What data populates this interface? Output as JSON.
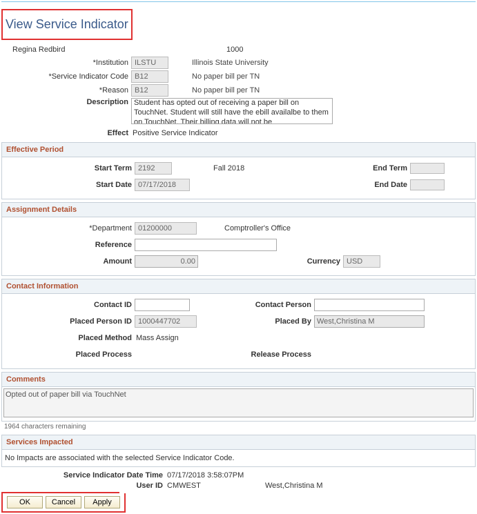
{
  "page_title": "View Service Indicator",
  "person_name": "Regina Redbird",
  "person_id": "1000",
  "fields": {
    "institution_label": "Institution",
    "institution_code": "ILSTU",
    "institution_desc": "Illinois State University",
    "si_code_label": "Service Indicator Code",
    "si_code": "B12",
    "si_code_desc": "No paper bill per TN",
    "reason_label": "Reason",
    "reason_code": "B12",
    "reason_desc": "No paper bill per TN",
    "description_label": "Description",
    "description_text": "Student has opted out of receiving a paper bill on TouchNet.  Student will still have the ebill availalbe to them on TouchNet.  Their billing data will not be",
    "effect_label": "Effect",
    "effect_value": "Positive Service Indicator"
  },
  "sections": {
    "effective_period": {
      "title": "Effective Period",
      "start_term_label": "Start Term",
      "start_term": "2192",
      "start_term_desc": "Fall 2018",
      "end_term_label": "End Term",
      "start_date_label": "Start Date",
      "start_date": "07/17/2018",
      "end_date_label": "End Date"
    },
    "assignment": {
      "title": "Assignment Details",
      "department_label": "Department",
      "department": "01200000",
      "department_desc": "Comptroller's Office",
      "reference_label": "Reference",
      "amount_label": "Amount",
      "amount": "0.00",
      "currency_label": "Currency",
      "currency": "USD"
    },
    "contact": {
      "title": "Contact Information",
      "contact_id_label": "Contact ID",
      "contact_person_label": "Contact Person",
      "placed_person_id_label": "Placed Person ID",
      "placed_person_id": "1000447702",
      "placed_by_label": "Placed By",
      "placed_by": "West,Christina M",
      "placed_method_label": "Placed Method",
      "placed_method": "Mass Assign",
      "placed_process_label": "Placed Process",
      "release_process_label": "Release Process"
    },
    "comments": {
      "title": "Comments",
      "text": "Opted out of paper bill via TouchNet",
      "remaining": "1964 characters remaining"
    },
    "services": {
      "title": "Services Impacted",
      "msg": "No Impacts are associated with the selected Service Indicator Code."
    }
  },
  "footer": {
    "datetime_label": "Service Indicator Date Time",
    "datetime": "07/17/2018  3:58:07PM",
    "userid_label": "User ID",
    "userid": "CMWEST",
    "username": "West,Christina M"
  },
  "buttons": {
    "ok": "OK",
    "cancel": "Cancel",
    "apply": "Apply"
  }
}
